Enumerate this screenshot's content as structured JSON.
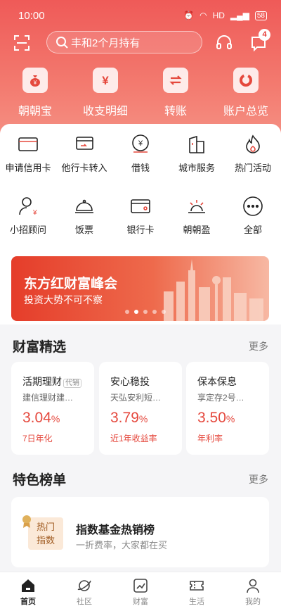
{
  "status": {
    "time": "10:00",
    "network": "HD",
    "battery": "58"
  },
  "header": {
    "search_placeholder": "丰和2个月持有",
    "message_count": "4"
  },
  "quick_actions": [
    {
      "label": "朝朝宝",
      "icon": "money-bag-icon"
    },
    {
      "label": "收支明细",
      "icon": "yuan-icon"
    },
    {
      "label": "转账",
      "icon": "transfer-icon"
    },
    {
      "label": "账户总览",
      "icon": "donut-chart-icon"
    }
  ],
  "services_row1": [
    {
      "label": "申请信用卡",
      "icon": "credit-card-icon"
    },
    {
      "label": "他行卡转入",
      "icon": "card-transfer-in-icon"
    },
    {
      "label": "借钱",
      "icon": "borrow-money-icon"
    },
    {
      "label": "城市服务",
      "icon": "city-building-icon"
    },
    {
      "label": "热门活动",
      "icon": "flame-icon"
    }
  ],
  "services_row2": [
    {
      "label": "小招顾问",
      "icon": "advisor-icon"
    },
    {
      "label": "饭票",
      "icon": "meal-cloche-icon"
    },
    {
      "label": "银行卡",
      "icon": "bank-card-icon"
    },
    {
      "label": "朝朝盈",
      "icon": "sunrise-icon"
    },
    {
      "label": "全部",
      "icon": "more-dots-icon"
    }
  ],
  "banner": {
    "title": "东方红财富峰会",
    "subtitle": "投资大势不可不察",
    "active_slide": 1,
    "slide_count": 5
  },
  "wealth": {
    "title": "财富精选",
    "more": "更多",
    "cards": [
      {
        "name": "活期理财",
        "tag": "代销",
        "sub": "建信理财建…",
        "rate": "3.04",
        "unit": "%",
        "label": "7日年化"
      },
      {
        "name": "安心稳投",
        "tag": "",
        "sub": "天弘安利短…",
        "rate": "3.79",
        "unit": "%",
        "label": "近1年收益率"
      },
      {
        "name": "保本保息",
        "tag": "",
        "sub": "享定存2号…",
        "rate": "3.50",
        "unit": "%",
        "label": "年利率"
      }
    ]
  },
  "ranking": {
    "title": "特色榜单",
    "more": "更多",
    "badge_line1": "热门",
    "badge_line2": "指数",
    "item_title": "指数基金热销榜",
    "item_sub": "一折费率，大家都在买"
  },
  "tabs": [
    {
      "label": "首页",
      "icon": "home-icon",
      "active": true
    },
    {
      "label": "社区",
      "icon": "planet-icon",
      "active": false
    },
    {
      "label": "财富",
      "icon": "trend-chart-icon",
      "active": false
    },
    {
      "label": "生活",
      "icon": "ticket-icon",
      "active": false
    },
    {
      "label": "我的",
      "icon": "person-icon",
      "active": false
    }
  ],
  "colors": {
    "brand": "#ef5a58",
    "rate": "#e5483d"
  }
}
